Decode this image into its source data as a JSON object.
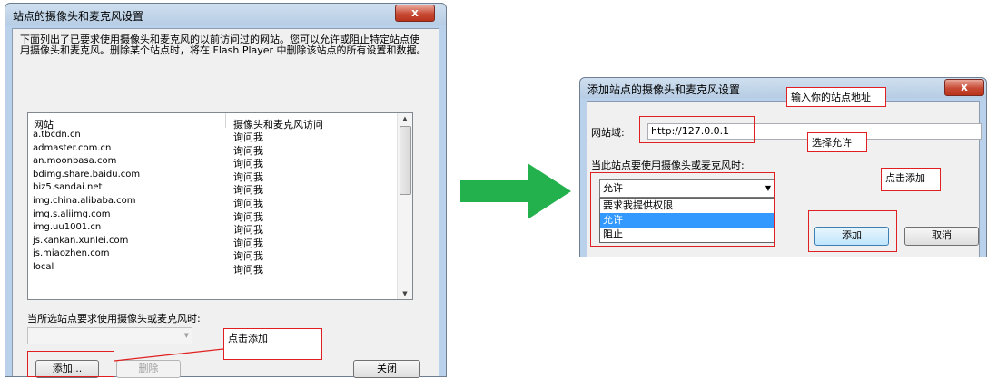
{
  "left_dialog": {
    "title": "站点的摄像头和麦克风设置",
    "close_label": "x",
    "description": "下面列出了已要求使用摄像头和麦克风的以前访问过的网站。您可以允许或阻止特定站点使用摄像头和麦克风。删除某个站点时，将在 Flash Player 中删除该站点的所有设置和数据。",
    "table": {
      "col_site": "网站",
      "col_access": "摄像头和麦克风访问",
      "rows": [
        {
          "site": "a.tbcdn.cn",
          "access": "询问我"
        },
        {
          "site": "admaster.com.cn",
          "access": "询问我"
        },
        {
          "site": "an.moonbasa.com",
          "access": "询问我"
        },
        {
          "site": "bdimg.share.baidu.com",
          "access": "询问我"
        },
        {
          "site": "biz5.sandai.net",
          "access": "询问我"
        },
        {
          "site": "img.china.alibaba.com",
          "access": "询问我"
        },
        {
          "site": "img.s.aliimg.com",
          "access": "询问我"
        },
        {
          "site": "img.uu1001.cn",
          "access": "询问我"
        },
        {
          "site": "js.kankan.xunlei.com",
          "access": "询问我"
        },
        {
          "site": "js.miaozhen.com",
          "access": "询问我"
        },
        {
          "site": "local",
          "access": "询问我"
        }
      ]
    },
    "prompt": "当所选站点要求使用摄像头或麦克风时:",
    "add_label": "添加...",
    "delete_label": "删除",
    "close_button_label": "关闭",
    "annotation_add": "点击添加"
  },
  "right_dialog": {
    "title": "添加站点的摄像头和麦克风设置",
    "close_label": "x",
    "site_label": "网站域:",
    "site_value": "http://127.0.0.1",
    "prompt": "当此站点要使用摄像头或麦克风时:",
    "combo_value": "允许",
    "options": [
      "要求我提供权限",
      "允许",
      "阻止"
    ],
    "selected_option": "允许",
    "add_label": "添加",
    "cancel_label": "取消",
    "annotation_address": "输入你的站点地址",
    "annotation_allow": "选择允许",
    "annotation_add": "点击添加"
  },
  "colors": {
    "annotation_red": "#e02020",
    "arrow_green": "#22b14c",
    "highlight_blue": "#3399ff"
  }
}
